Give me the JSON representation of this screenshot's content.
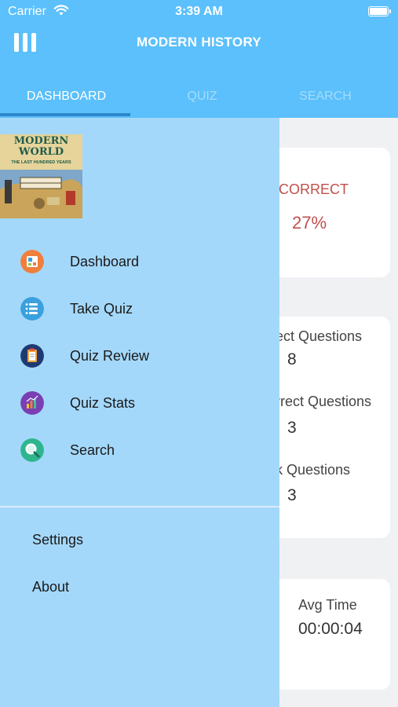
{
  "status_bar": {
    "carrier": "Carrier",
    "time": "3:39 AM"
  },
  "header": {
    "title": "MODERN HISTORY"
  },
  "tabs": [
    {
      "label": "DASHBOARD",
      "active": true
    },
    {
      "label": "QUIZ",
      "active": false
    },
    {
      "label": "SEARCH",
      "active": false
    }
  ],
  "dashboard": {
    "incorrect_label": "ICORRECT",
    "incorrect_value": "27%",
    "questions": [
      {
        "label": "ect Questions",
        "value": "8"
      },
      {
        "label": "rrect Questions",
        "value": "3"
      },
      {
        "label": "k Questions",
        "value": "3"
      }
    ],
    "avg_time_label": "Avg Time",
    "avg_time_value": "00:00:04"
  },
  "drawer": {
    "logo": {
      "title_line1": "MODERN",
      "title_line2": "WORLD",
      "subtitle": "THE LAST HUNDRED YEARS"
    },
    "menu": [
      {
        "label": "Dashboard",
        "icon": "dashboard-icon",
        "color": "#f07e3c"
      },
      {
        "label": "Take Quiz",
        "icon": "quiz-list-icon",
        "color": "#3aa0de"
      },
      {
        "label": "Quiz Review",
        "icon": "clipboard-icon",
        "color": "#1d3b72"
      },
      {
        "label": "Quiz Stats",
        "icon": "stats-icon",
        "color": "#7a3fb3"
      },
      {
        "label": "Search",
        "icon": "search-icon",
        "color": "#2eb58f"
      }
    ],
    "settings_label": "Settings",
    "about_label": "About"
  },
  "colors": {
    "header": "#5bc0fb",
    "drawer": "#a4d8fa",
    "incorrect": "#c0504d",
    "tab_indicator": "#2f86cc"
  }
}
